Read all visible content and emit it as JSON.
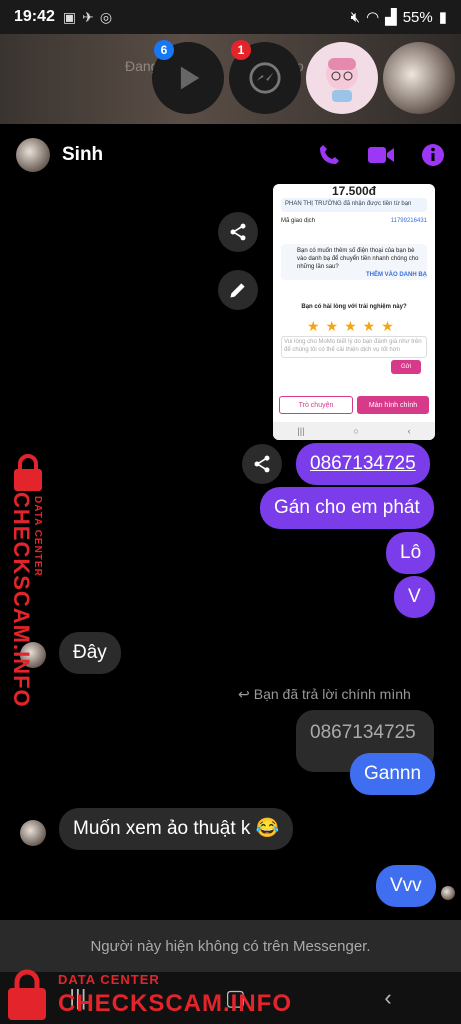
{
  "status_bar": {
    "time": "19:42",
    "battery": "55%"
  },
  "chat_heads": {
    "ghost_text": "Đang",
    "ghost_text_tail": "o",
    "badges": [
      "6",
      "1"
    ]
  },
  "header": {
    "contact_name": "Sinh"
  },
  "screenshot_card": {
    "amount": "17.500đ",
    "notice": "PHAN THỊ TRƯỜNG đã nhận được tiền từ bạn",
    "txn_label": "Mã giao dịch",
    "txn_value": "11799216431",
    "save_prompt": "Bạn có muốn thêm số điện thoại của bạn bè vào danh bạ để chuyển tiền nhanh chóng cho những lần sau?",
    "save_link": "THÊM VÀO DANH BẠ",
    "rating_question": "Bạn có hài lòng với trải nghiệm này?",
    "feedback_placeholder": "Vui lòng cho MoMo biết lý do bạn đánh giá như trên để chúng tôi có thể cải thiện dịch vụ tốt hơn",
    "send_label": "Gửi",
    "chat_button": "Trò chuyện",
    "home_button": "Màn hình chính"
  },
  "messages": {
    "m1": "0867134725",
    "m2": "Gán cho em phát",
    "m3": "Lô",
    "m4": "V",
    "m5": "Đây",
    "reply_note": "Bạn đã trả lời chính mình",
    "quoted": "0867134725",
    "m6": "Gannn",
    "m7": "Muốn xem ảo thuật k 😂",
    "m8": "Vvv"
  },
  "footer": {
    "notice": "Người này hiện không có trên Messenger."
  },
  "watermark": {
    "small": "DATA CENTER",
    "large": "CHECKSCAM.INFO"
  },
  "colors": {
    "accent": "#9b37f5",
    "bubble_purple": "#7b3dea",
    "bubble_blue": "#3f6ef0",
    "watermark": "#e4242b"
  }
}
